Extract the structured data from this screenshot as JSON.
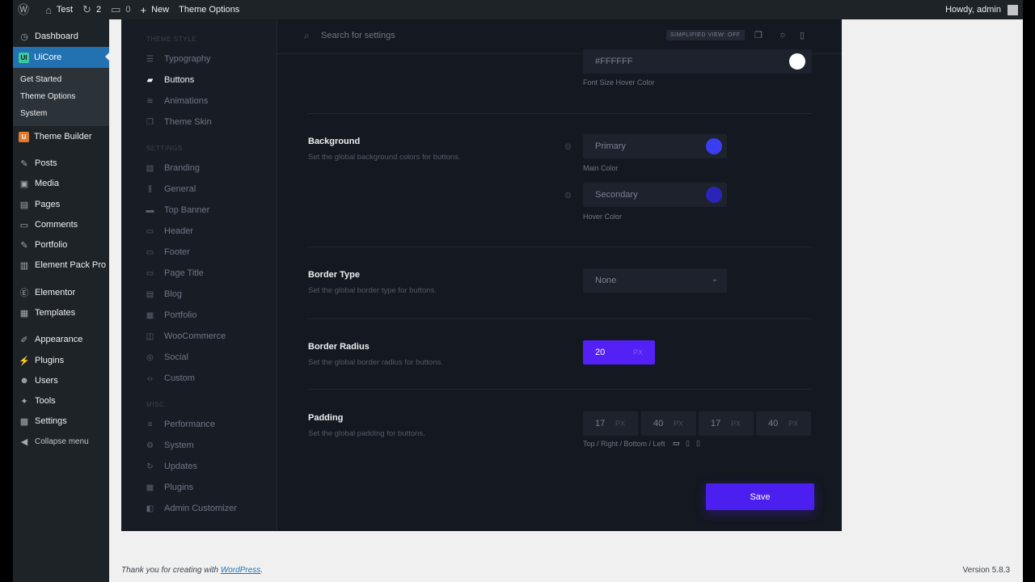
{
  "admin_bar": {
    "site_name": "Test",
    "updates_count": "2",
    "comments_count": "0",
    "new_label": "New",
    "theme_options_label": "Theme Options",
    "howdy": "Howdy, admin"
  },
  "wp_menu": {
    "dashboard": "Dashboard",
    "uicore": "UiCore",
    "uicore_badge": "UI",
    "sub": [
      "Get Started",
      "Theme Options",
      "System"
    ],
    "theme_builder": "Theme Builder",
    "theme_builder_badge": "U",
    "posts": "Posts",
    "media": "Media",
    "pages": "Pages",
    "comments": "Comments",
    "portfolio": "Portfolio",
    "element_pack_pro": "Element Pack Pro",
    "elementor": "Elementor",
    "templates": "Templates",
    "appearance": "Appearance",
    "plugins": "Plugins",
    "users": "Users",
    "tools": "Tools",
    "settings": "Settings",
    "collapse": "Collapse menu"
  },
  "inner_nav": {
    "theme_style_head": "THEME STYLE",
    "typography": "Typography",
    "buttons": "Buttons",
    "animations": "Animations",
    "theme_skin": "Theme Skin",
    "settings_head": "SETTINGS",
    "branding": "Branding",
    "general": "General",
    "top_banner": "Top Banner",
    "header": "Header",
    "footer": "Footer",
    "page_title": "Page Title",
    "blog": "Blog",
    "portfolio": "Portfolio",
    "woocommerce": "WooCommerce",
    "social": "Social",
    "custom": "Custom",
    "misc_head": "MISC",
    "performance": "Performance",
    "system": "System",
    "updates": "Updates",
    "plugins": "Plugins",
    "admin_customizer": "Admin Customizer"
  },
  "topbar": {
    "search_placeholder": "Search for settings",
    "simplified_view": "SIMPLIFIED VIEW: OFF"
  },
  "fields": {
    "font_hover": {
      "value": "#FFFFFF",
      "label": "Font Size  Hover Color",
      "swatch": "#ffffff"
    },
    "background": {
      "title": "Background",
      "desc": "Set the global background colors for buttons.",
      "main": {
        "value": "Primary",
        "label": "Main Color",
        "swatch": "#3b3df0"
      },
      "hover": {
        "value": "Secondary",
        "label": "Hover Color",
        "swatch": "#2a25b8"
      }
    },
    "border_type": {
      "title": "Border Type",
      "desc": "Set the global border type for buttons.",
      "value": "None"
    },
    "border_radius": {
      "title": "Border Radius",
      "desc": "Set the global border radius for buttons.",
      "value": "20",
      "unit": "PX"
    },
    "padding": {
      "title": "Padding",
      "desc": "Set the global padding for buttons.",
      "values": [
        "17",
        "40",
        "17",
        "40"
      ],
      "unit": "PX",
      "label": "Top / Right / Bottom / Left"
    }
  },
  "save_label": "Save",
  "footer": {
    "thanks_prefix": "Thank you for creating with ",
    "wordpress_link": "WordPress",
    "thanks_suffix": ".",
    "version": "Version 5.8.3"
  },
  "colors": {
    "accent": "#5320f5",
    "save": "#4a1ff0",
    "wp_active": "#2271b1"
  }
}
